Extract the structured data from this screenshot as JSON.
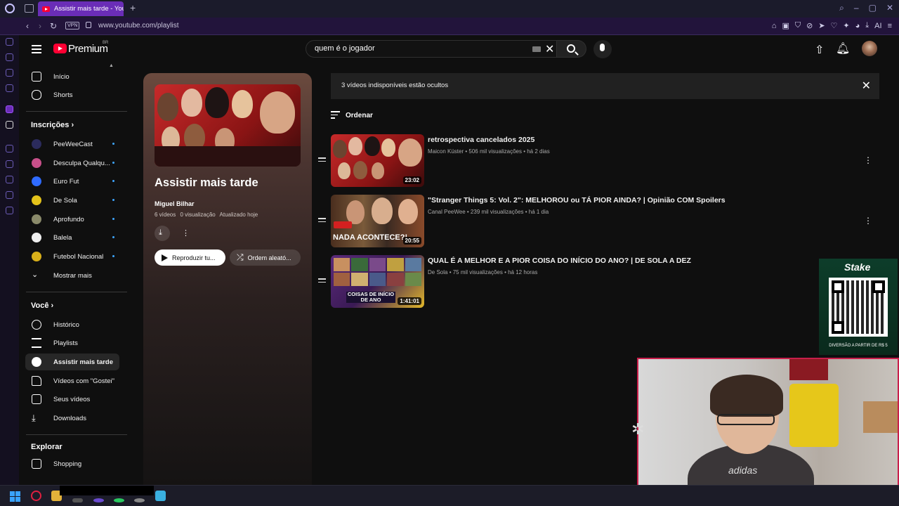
{
  "browser": {
    "tab_title": "Assistir mais tarde - YouTube",
    "url": "www.youtube.com/playlist",
    "vpn_label": "VPN",
    "ai_label": "AI"
  },
  "masthead": {
    "logo_text": "Premium",
    "region": "BR",
    "search_value": "quem é o jogador",
    "icons": [
      "hamburger-icon",
      "search-icon",
      "mic-icon",
      "upload-icon",
      "bell-icon"
    ]
  },
  "sidebar": {
    "top": [
      {
        "label": "Início",
        "icon": "home-icon"
      },
      {
        "label": "Shorts",
        "icon": "shorts-icon"
      }
    ],
    "subs_header": "Inscrições",
    "subscriptions": [
      {
        "label": "PeeWeeCast",
        "color": "#2b2b5c"
      },
      {
        "label": "Desculpa Qualqu...",
        "color": "#c8508a"
      },
      {
        "label": "Euro Fut",
        "color": "#2f6bff"
      },
      {
        "label": "De Sola",
        "color": "#e3c21a"
      },
      {
        "label": "Aprofundo",
        "color": "#8a8a6a"
      },
      {
        "label": "Balela",
        "color": "#eeeeee"
      },
      {
        "label": "Futebol Nacional",
        "color": "#d9b01a"
      }
    ],
    "show_more": "Mostrar mais",
    "you_header": "Você",
    "you": [
      {
        "label": "Histórico",
        "icon": "history-icon"
      },
      {
        "label": "Playlists",
        "icon": "playlists-icon"
      },
      {
        "label": "Assistir mais tarde",
        "icon": "clock-icon"
      },
      {
        "label": "Vídeos com \"Gostei\"",
        "icon": "thumbs-up-icon"
      },
      {
        "label": "Seus vídeos",
        "icon": "your-videos-icon"
      },
      {
        "label": "Downloads",
        "icon": "download-icon"
      }
    ],
    "explore_header": "Explorar",
    "explore": [
      {
        "label": "Shopping",
        "icon": "shopping-icon"
      }
    ]
  },
  "playlist": {
    "title": "Assistir mais tarde",
    "owner": "Miguel Bilhar",
    "video_count": "6 vídeos",
    "views": "0 visualização",
    "updated": "Atualizado hoje",
    "play_all": "Reproduzir tu...",
    "shuffle": "Ordem aleató..."
  },
  "notice": "3 vídeos indisponíveis estão ocultos",
  "sort_label": "Ordenar",
  "videos": [
    {
      "title": "retrospectiva cancelados 2025",
      "channel": "Maicon Küster",
      "views": "506 mil visualizações",
      "age": "há 2 dias",
      "duration": "23:02"
    },
    {
      "title": "\"Stranger Things 5: Vol. 2\": MELHOROU ou TÁ PIOR AINDA? | Opinião COM Spoilers",
      "channel": "Canal PeeWee",
      "views": "239 mil visualizações",
      "age": "há 1 dia",
      "duration": "20:55",
      "thumb_text": "NADA ACONTECE?!"
    },
    {
      "title": "QUAL É A MELHOR E A PIOR COISA DO INÍCIO DO ANO? | DE SOLA A DEZ",
      "channel": "De Sola",
      "views": "75 mil visualizações",
      "age": "há 12 horas",
      "duration": "1:41:01",
      "thumb_text": "COISAS DE INÍCIO DE ANO"
    }
  ],
  "ad": {
    "brand": "Stake",
    "tagline": "DIVERSÃO A PARTIR DE R$ 5"
  },
  "webcam": {
    "shirt_brand": "adidas"
  },
  "colors": {
    "accent_red": "#ff0033",
    "tab_purple": "#6a2db7",
    "subscription_dot": "#3ea6ff",
    "cam_border": "#c81e4a"
  }
}
